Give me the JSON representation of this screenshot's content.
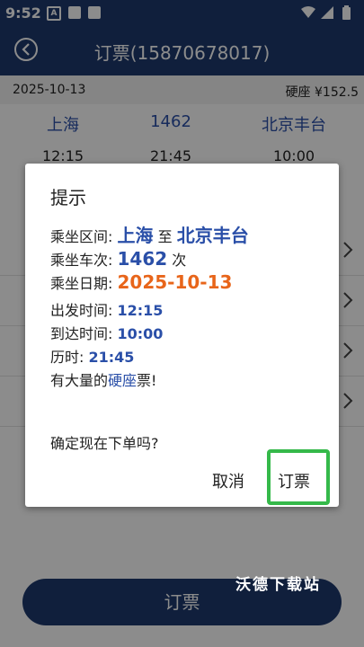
{
  "status_bar": {
    "time": "9:52",
    "a_badge": "A"
  },
  "header": {
    "title": "订票(15870678017)"
  },
  "trip": {
    "date": "2025-10-13",
    "seat_price": "硬座 ¥152.5",
    "from": "上海",
    "train": "1462",
    "to": "北京丰台",
    "depart": "12:15",
    "duration": "21:45",
    "arrive": "10:00"
  },
  "dialog": {
    "title": "提示",
    "route_label": "乘坐区间:",
    "route_from": "上海",
    "route_sep": "至",
    "route_to": "北京丰台",
    "train_label": "乘坐车次:",
    "train_no": "1462",
    "train_suffix": "次",
    "date_label": "乘坐日期:",
    "date_value": "2025-10-13",
    "depart_label": "出发时间:",
    "depart_value": "12:15",
    "arrive_label": "到达时间:",
    "arrive_value": "10:00",
    "duration_label": "历时:",
    "duration_value": "21:45",
    "avail_prefix": "有大量的",
    "avail_seat": "硬座",
    "avail_suffix": "票!",
    "confirm_text": "确定现在下单吗?",
    "cancel_label": "取消",
    "order_label": "订票"
  },
  "bottom_button": {
    "label": "订票"
  },
  "watermark": "沃德下载站",
  "colors": {
    "primary": "#1e3a6e",
    "accent_blue": "#2a4fa8",
    "accent_orange": "#e8651a",
    "highlight_green": "#35b94a"
  }
}
